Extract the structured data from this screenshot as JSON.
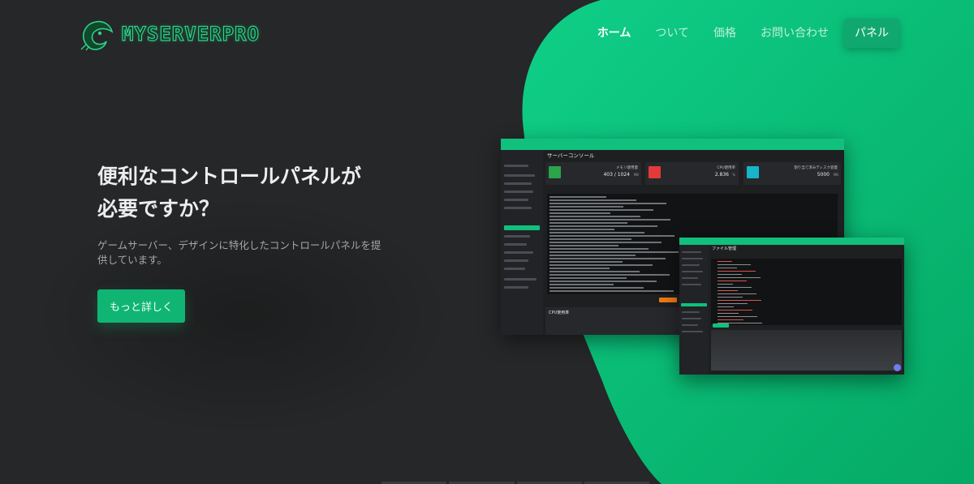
{
  "brand": {
    "logo_text": "MYSERVERPRO",
    "accent": "#11c07c"
  },
  "nav": {
    "items": [
      {
        "label": "ホーム",
        "active": true
      },
      {
        "label": "ついて",
        "active": false
      },
      {
        "label": "価格",
        "active": false
      },
      {
        "label": "お問い合わせ",
        "active": false
      }
    ],
    "panel_button": "パネル"
  },
  "hero": {
    "title_line1": "便利なコントロールパネルが",
    "title_line2": "必要ですか？",
    "subtitle": "ゲームサーバー、デザインに特化したコントロールパネルを提供しています。",
    "cta": "もっと詳しく"
  },
  "preview": {
    "console_title": "サーバーコンソール",
    "memory_label": "メモリ使用量",
    "memory_value": "403 / 1024",
    "memory_unit": "MB",
    "cpu_label": "CPU使用率",
    "cpu_value": "2.836",
    "cpu_unit": "%",
    "disk_label": "割り当て済みディスク容量",
    "disk_value": "5000",
    "disk_unit": "MB",
    "cpu_chart_title": "CPU使用率",
    "file_manager_title": "ファイル管理",
    "colors": {
      "memory": "#2aa34a",
      "cpu": "#e23a3a",
      "disk": "#16b5c9",
      "send": "#f07a12"
    }
  }
}
